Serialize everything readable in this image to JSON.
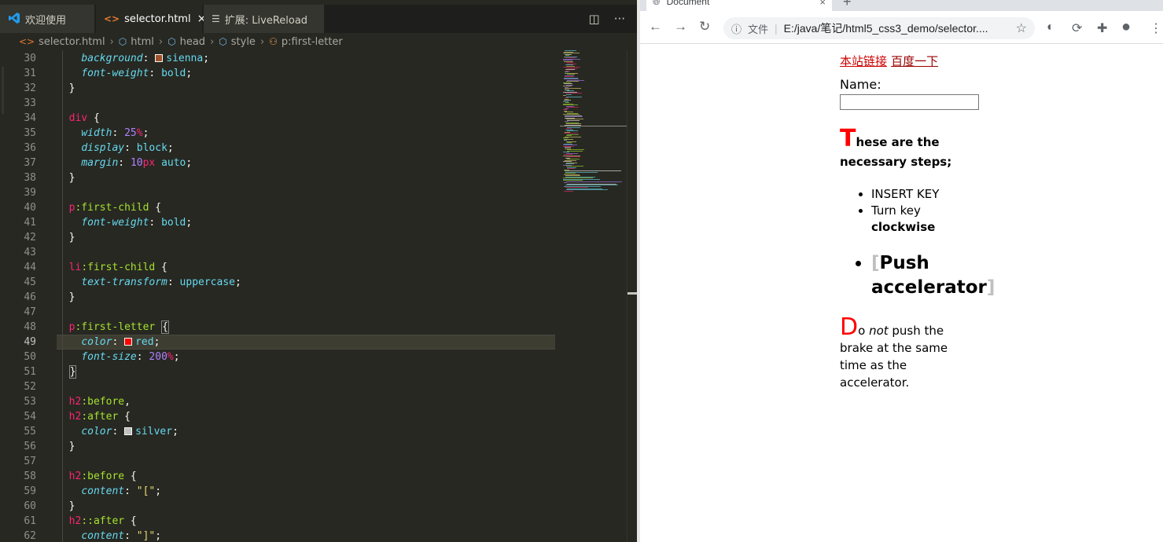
{
  "vscode": {
    "tabs": [
      {
        "label": "欢迎使用",
        "icon": "vscode-logo-icon"
      },
      {
        "label": "selector.html",
        "icon": "html-file-icon",
        "close": "×"
      },
      {
        "label": "扩展: LiveReload",
        "icon": "extension-icon"
      }
    ],
    "actions": {
      "split": "◫",
      "more": "···"
    },
    "breadcrumb": [
      "selector.html",
      "html",
      "head",
      "style",
      "p:first-letter"
    ],
    "first_line": 30,
    "current_line": 49,
    "lines": [
      [
        [
          "    ",
          ""
        ],
        [
          "background",
          "prop"
        ],
        [
          ": ",
          ""
        ],
        [
          "■sienna",
          "swatch:#a0522d"
        ],
        [
          ";",
          ""
        ]
      ],
      [
        [
          "    ",
          ""
        ],
        [
          "font-weight",
          "prop"
        ],
        [
          ": ",
          ""
        ],
        [
          "bold",
          "val"
        ],
        [
          ";",
          ""
        ]
      ],
      [
        [
          "  }",
          ""
        ]
      ],
      [
        [
          "",
          ""
        ]
      ],
      [
        [
          "  ",
          ""
        ],
        [
          "div",
          "sel"
        ],
        [
          " {",
          ""
        ]
      ],
      [
        [
          "    ",
          ""
        ],
        [
          "width",
          "prop"
        ],
        [
          ": ",
          ""
        ],
        [
          "25",
          "num"
        ],
        [
          "%",
          "unit"
        ],
        [
          ";",
          ""
        ]
      ],
      [
        [
          "    ",
          ""
        ],
        [
          "display",
          "prop"
        ],
        [
          ": ",
          ""
        ],
        [
          "block",
          "val"
        ],
        [
          ";",
          ""
        ]
      ],
      [
        [
          "    ",
          ""
        ],
        [
          "margin",
          "prop"
        ],
        [
          ": ",
          ""
        ],
        [
          "10",
          "num"
        ],
        [
          "px",
          "unit"
        ],
        [
          " ",
          ""
        ],
        [
          "auto",
          "val"
        ],
        [
          ";",
          ""
        ]
      ],
      [
        [
          "  }",
          ""
        ]
      ],
      [
        [
          "",
          ""
        ]
      ],
      [
        [
          "  ",
          ""
        ],
        [
          "p",
          "sel"
        ],
        [
          ":first-child",
          "pseudo"
        ],
        [
          " {",
          ""
        ]
      ],
      [
        [
          "    ",
          ""
        ],
        [
          "font-weight",
          "prop"
        ],
        [
          ": ",
          ""
        ],
        [
          "bold",
          "val"
        ],
        [
          ";",
          ""
        ]
      ],
      [
        [
          "  }",
          ""
        ]
      ],
      [
        [
          "",
          ""
        ]
      ],
      [
        [
          "  ",
          ""
        ],
        [
          "li",
          "sel"
        ],
        [
          ":first-child",
          "pseudo"
        ],
        [
          " {",
          ""
        ]
      ],
      [
        [
          "    ",
          ""
        ],
        [
          "text-transform",
          "prop"
        ],
        [
          ": ",
          ""
        ],
        [
          "uppercase",
          "val"
        ],
        [
          ";",
          ""
        ]
      ],
      [
        [
          "  }",
          ""
        ]
      ],
      [
        [
          "",
          ""
        ]
      ],
      [
        [
          "  ",
          ""
        ],
        [
          "p",
          "sel"
        ],
        [
          ":first-letter",
          "pseudo"
        ],
        [
          " ",
          ""
        ],
        [
          "{",
          "brace"
        ]
      ],
      [
        [
          "    ",
          ""
        ],
        [
          "color",
          "prop"
        ],
        [
          ": ",
          ""
        ],
        [
          "■red",
          "swatch:#ff0000"
        ],
        [
          ";",
          ""
        ]
      ],
      [
        [
          "    ",
          ""
        ],
        [
          "font-size",
          "prop"
        ],
        [
          ": ",
          ""
        ],
        [
          "200",
          "num"
        ],
        [
          "%",
          "unit"
        ],
        [
          ";",
          ""
        ]
      ],
      [
        [
          "  ",
          ""
        ],
        [
          "}",
          "brace"
        ]
      ],
      [
        [
          "",
          ""
        ]
      ],
      [
        [
          "  ",
          ""
        ],
        [
          "h2",
          "sel"
        ],
        [
          ":before",
          "pseudo"
        ],
        [
          ",",
          ""
        ]
      ],
      [
        [
          "  ",
          ""
        ],
        [
          "h2",
          "sel"
        ],
        [
          ":after",
          "pseudo"
        ],
        [
          " {",
          ""
        ]
      ],
      [
        [
          "    ",
          ""
        ],
        [
          "color",
          "prop"
        ],
        [
          ": ",
          ""
        ],
        [
          "■silver",
          "swatch:#c0c0c0"
        ],
        [
          ";",
          ""
        ]
      ],
      [
        [
          "  }",
          ""
        ]
      ],
      [
        [
          "",
          ""
        ]
      ],
      [
        [
          "  ",
          ""
        ],
        [
          "h2",
          "sel"
        ],
        [
          ":before",
          "pseudo"
        ],
        [
          " {",
          ""
        ]
      ],
      [
        [
          "    ",
          ""
        ],
        [
          "content",
          "prop"
        ],
        [
          ": ",
          ""
        ],
        [
          "\"[\"",
          "str"
        ],
        [
          ";",
          ""
        ]
      ],
      [
        [
          "  }",
          ""
        ]
      ],
      [
        [
          "  ",
          ""
        ],
        [
          "h2",
          "sel"
        ],
        [
          "::after",
          "pseudo"
        ],
        [
          " {",
          ""
        ]
      ],
      [
        [
          "    ",
          ""
        ],
        [
          "content",
          "prop"
        ],
        [
          ": ",
          ""
        ],
        [
          "\"]\"",
          "str"
        ],
        [
          ";",
          ""
        ]
      ]
    ]
  },
  "browser": {
    "tab_title": "Document",
    "tab_close": "×",
    "new_tab": "+",
    "nav": {
      "back": "←",
      "forward": "→",
      "reload": "↻"
    },
    "address": {
      "info": "ⓘ",
      "label": "文件",
      "url": "E:/java/笔记/html5_css3_demo/selector....",
      "star": "☆"
    },
    "extensions": [
      "◐",
      "⟳",
      "✚",
      "●",
      "⋮"
    ],
    "page": {
      "link1": "本站链接",
      "link2": "百度一下",
      "name_label": "Name:",
      "para1_first": "T",
      "para1_rest": "hese are the necessary steps;",
      "list": [
        "insert key",
        "Turn key",
        "clockwise"
      ],
      "h2_open": "[",
      "h2_text": "Push accelerator",
      "h2_close": "]",
      "para2_first": "D",
      "para2_a": "o ",
      "para2_em": "not",
      "para2_b": " push the brake at the same time as the accelerator."
    }
  }
}
